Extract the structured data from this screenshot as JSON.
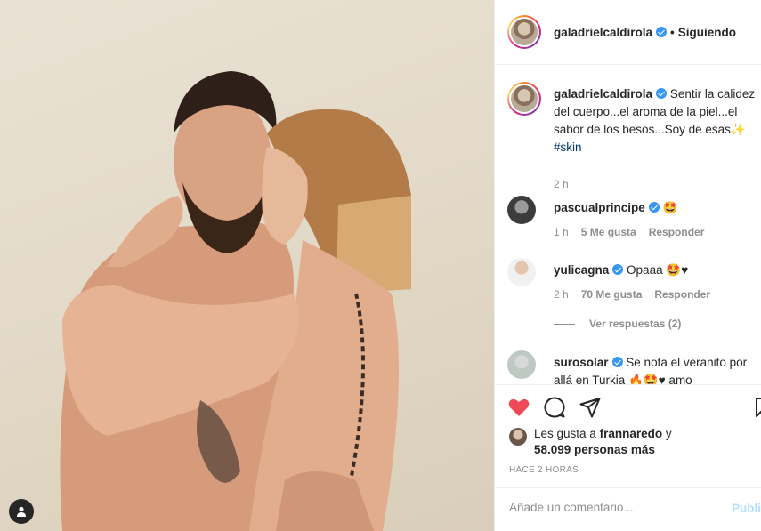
{
  "post": {
    "author": "galadrielcaldirola",
    "follow_status": "Siguiendo",
    "separator": "•",
    "caption_text": "Sentir la calidez del cuerpo...el aroma de la piel...el sabor de los besos...Soy de esas",
    "caption_emoji": "✨",
    "hashtag": "#skin",
    "caption_time": "2 h"
  },
  "comments": [
    {
      "username": "pascualprincipe",
      "text": "🤩",
      "time": "1 h",
      "likes": "5 Me gusta",
      "reply": "Responder"
    },
    {
      "username": "yulicagna",
      "text": "Opaaa 🤩♥",
      "time": "2 h",
      "likes": "70 Me gusta",
      "reply": "Responder",
      "view_replies": "Ver respuestas (2)"
    },
    {
      "username": "surosolar",
      "text": "Se nota el veranito por allá en Turkia 🔥🤩♥ amo"
    }
  ],
  "likes_summary": {
    "prefix": "Les gusta a",
    "user": "frannaredo",
    "connector": "y",
    "count": "58.099 personas más"
  },
  "post_time": "HACE 2 HORAS",
  "comment_box": {
    "placeholder": "Añade un comentario...",
    "publish_label": "Publicar"
  },
  "colors": {
    "like_active": "#ed4956",
    "verified": "#3897f0",
    "hashtag": "#00376b",
    "publish_disabled": "#b2dffc"
  }
}
